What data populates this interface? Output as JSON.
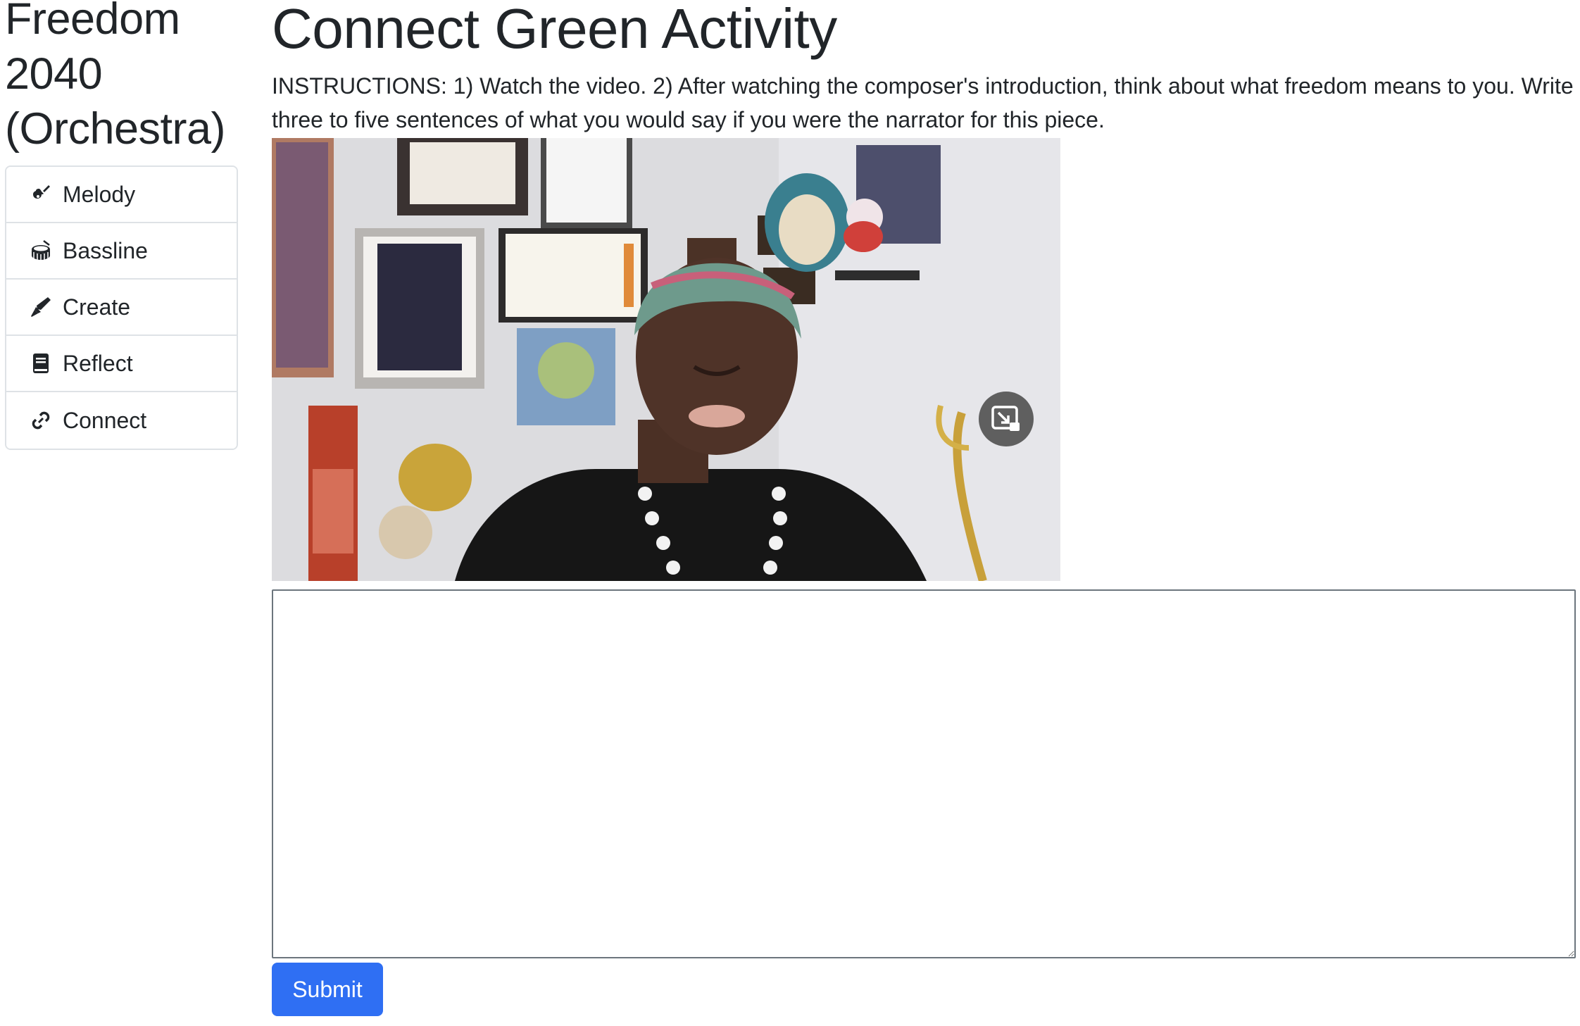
{
  "sidebar": {
    "title": "Freedom 2040 (Orchestra)",
    "items": [
      {
        "label": "Melody",
        "icon": "guitar-icon"
      },
      {
        "label": "Bassline",
        "icon": "drum-icon"
      },
      {
        "label": "Create",
        "icon": "pen-icon"
      },
      {
        "label": "Reflect",
        "icon": "book-icon"
      },
      {
        "label": "Connect",
        "icon": "link-icon"
      }
    ]
  },
  "main": {
    "title": "Connect Green Activity",
    "instructions": "INSTRUCTIONS: 1) Watch the video. 2) After watching the composer's introduction, think about what freedom means to you. Write three to five sentences of what you would say if you were the narrator for this piece.",
    "video": {
      "pip_icon": "picture-in-picture-icon"
    },
    "response": {
      "value": "",
      "placeholder": ""
    },
    "submit_label": "Submit"
  },
  "colors": {
    "accent": "#2f6ff3",
    "border": "#dee2e6",
    "text": "#212529"
  }
}
